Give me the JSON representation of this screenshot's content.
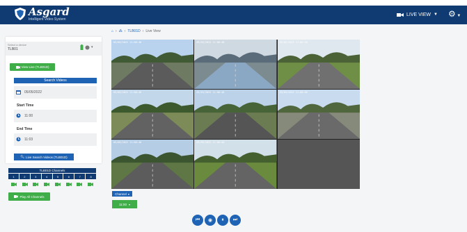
{
  "header": {
    "brand": "Asgard",
    "tagline": "Intelligent Video System",
    "live_view_label": "LIVE VIEW",
    "colors": {
      "bar": "#0f3b72"
    }
  },
  "sidebar": {
    "device_label": "Select a device",
    "device_value": "TLB01",
    "view_live_label": "View Live (TLB01D)",
    "search_title": "Search Videos",
    "date_value": "05/05/2022",
    "start_time_label": "Start Time",
    "start_time_value": "11:00",
    "end_time_label": "End Time",
    "end_time_value": "11:03",
    "search_button_label": "Live Search Videos (TLB01D)",
    "channels_title": "TLB01D Channels",
    "channels": [
      "1",
      "2",
      "3",
      "4",
      "5",
      "6",
      "7",
      "8"
    ],
    "play_all_label": "Play All Channels"
  },
  "breadcrumb": {
    "home_icon": "home-icon",
    "device": "TLB01D",
    "current": "Live View"
  },
  "cameras": [
    {
      "timestamp": "05/05/2022 11:00:40"
    },
    {
      "timestamp": "05/05/2022 11:00:40"
    },
    {
      "timestamp": "05/05/2022 11:00:40"
    },
    {
      "timestamp": "05/05/2022 11:00:40"
    },
    {
      "timestamp": "05/05/2022 11:00:40"
    },
    {
      "timestamp": "05/05/2022 11:00:40"
    },
    {
      "timestamp": "05/05/2022 11:00:40"
    },
    {
      "timestamp": "05/05/2022 11:00:40"
    }
  ],
  "footer": {
    "channel_label": "Channel",
    "time_label": "11:00",
    "controls": [
      "rewind-icon",
      "record-icon",
      "pause-icon",
      "forward-icon"
    ]
  }
}
